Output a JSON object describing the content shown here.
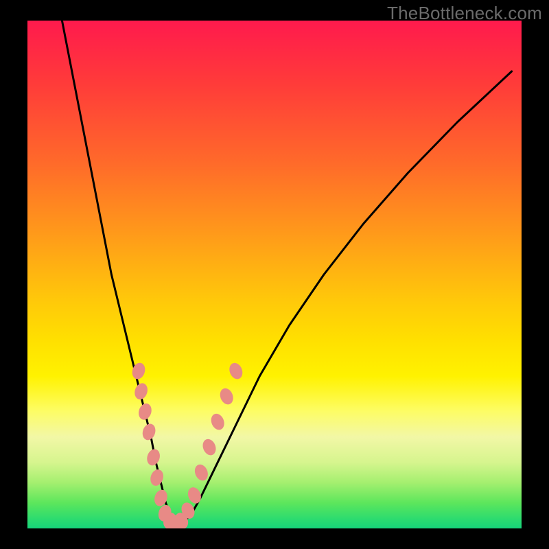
{
  "watermark": "TheBottleneck.com",
  "chart_data": {
    "type": "line",
    "title": "",
    "xlabel": "",
    "ylabel": "",
    "xlim": [
      0,
      100
    ],
    "ylim": [
      0,
      100
    ],
    "grid": false,
    "legend": false,
    "series": [
      {
        "name": "bottleneck-curve",
        "x": [
          7,
          9,
          11,
          13,
          15,
          17,
          19,
          21,
          23,
          25,
          26,
          27,
          28,
          29,
          30,
          31,
          33,
          35,
          38,
          42,
          47,
          53,
          60,
          68,
          77,
          87,
          98
        ],
        "y": [
          100,
          90,
          80,
          70,
          60,
          50,
          42,
          34,
          26,
          18,
          13,
          9,
          5,
          2.5,
          1,
          1,
          2.5,
          6,
          12,
          20,
          30,
          40,
          50,
          60,
          70,
          80,
          90
        ]
      }
    ],
    "markers": {
      "name": "highlight-beads",
      "color": "#e88a86",
      "points": [
        {
          "x": 22.5,
          "y": 31
        },
        {
          "x": 23.0,
          "y": 27
        },
        {
          "x": 23.8,
          "y": 23
        },
        {
          "x": 24.6,
          "y": 19
        },
        {
          "x": 25.5,
          "y": 14
        },
        {
          "x": 26.2,
          "y": 10
        },
        {
          "x": 27.0,
          "y": 6
        },
        {
          "x": 27.8,
          "y": 3
        },
        {
          "x": 28.8,
          "y": 1.5
        },
        {
          "x": 30.0,
          "y": 1
        },
        {
          "x": 31.2,
          "y": 1.5
        },
        {
          "x": 32.5,
          "y": 3.5
        },
        {
          "x": 33.8,
          "y": 6.5
        },
        {
          "x": 35.2,
          "y": 11
        },
        {
          "x": 36.8,
          "y": 16
        },
        {
          "x": 38.5,
          "y": 21
        },
        {
          "x": 40.3,
          "y": 26
        },
        {
          "x": 42.2,
          "y": 31
        }
      ]
    }
  }
}
